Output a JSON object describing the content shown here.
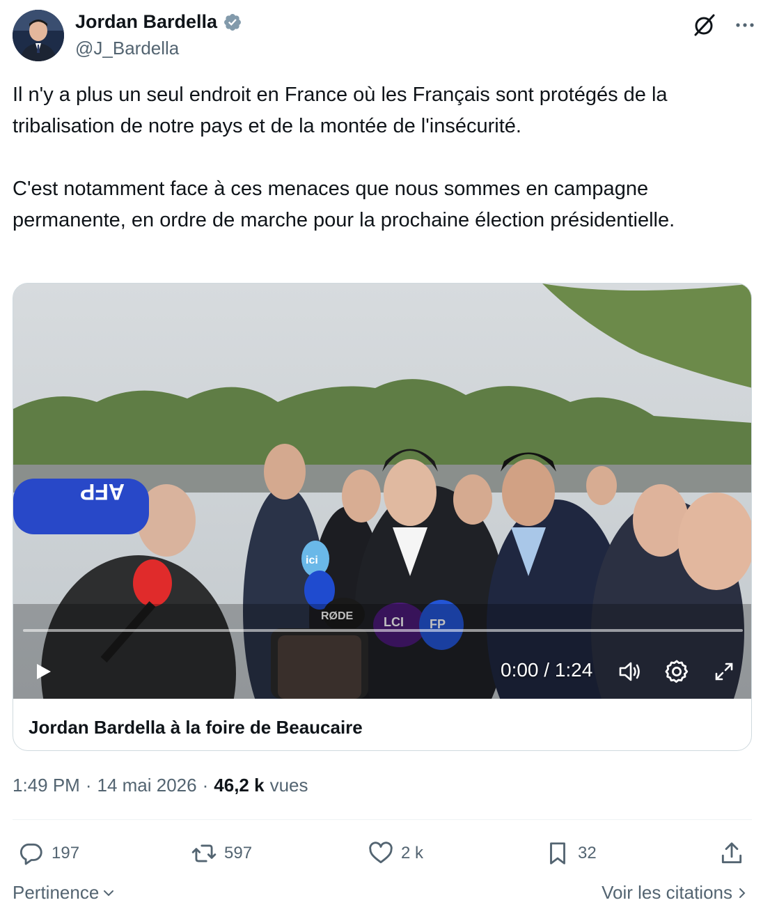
{
  "author": {
    "display_name": "Jordan Bardella",
    "handle": "@J_Bardella",
    "verified": true,
    "verified_color": "#829aab"
  },
  "header_icons": [
    "grok-icon",
    "more-icon"
  ],
  "tweet": {
    "text": "Il n'y a plus un seul endroit en France où les Français sont protégés de la tribalisation de notre pays et de la montée de l'insécurité.\n\nC'est notamment face à ces menaces que nous sommes en campagne permanente, en ordre de marche pour la prochaine élection présidentielle."
  },
  "video": {
    "timecode": "0:00 / 1:24",
    "progress_fraction": 0.0,
    "card_title": "Jordan Bardella à la foire de Beaucaire",
    "mic_labels": [
      "AFP",
      "ici",
      "RØDE",
      "LCI",
      "AFP"
    ]
  },
  "meta": {
    "time": "1:49 PM",
    "date": "14 mai 2026",
    "views_count": "46,2 k",
    "views_label": "vues"
  },
  "actions": {
    "replies": "197",
    "reposts": "597",
    "likes": "2 k",
    "bookmarks": "32"
  },
  "footer": {
    "sort_label": "Pertinence",
    "quotes_link": "Voir les citations"
  },
  "colors": {
    "text_primary": "#0f1419",
    "text_secondary": "#536471",
    "border": "#cfd9de"
  }
}
